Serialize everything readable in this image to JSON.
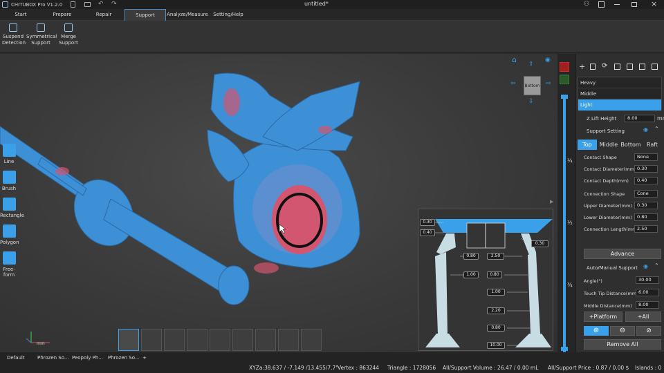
{
  "window": {
    "app_title": "CHITUBOX Pro V1.2.0",
    "doc_title": "untitled*"
  },
  "menu": [
    "Start",
    "Prepare",
    "Repair",
    "Support",
    "Analyze/Measure",
    "Setting/Help"
  ],
  "toolbar": [
    {
      "label1": "Suspend",
      "label2": "Detection",
      "icon": "suspend-detection-icon"
    },
    {
      "label1": "Symmetrical",
      "label2": "Support",
      "icon": "symmetrical-support-icon"
    },
    {
      "label1": "Merge",
      "label2": "Support",
      "icon": "merge-support-icon"
    }
  ],
  "left_tools": [
    "Line",
    "Brush",
    "Rectangle",
    "Polygon",
    "Free-form"
  ],
  "view_cube": {
    "label": "Bottom"
  },
  "slider_marks": [
    "¼",
    "½",
    "¾"
  ],
  "presets": [
    "Heavy",
    "Middle",
    "Light"
  ],
  "z_lift": {
    "label": "Z Lift Height",
    "value": "8.00",
    "unit": "mm"
  },
  "support_setting": {
    "title": "Support Setting",
    "tabs": [
      "Top",
      "Middle",
      "Bottom",
      "Raft"
    ],
    "rows": [
      {
        "label": "Contact Shape",
        "value": "None"
      },
      {
        "label": "Contact Diameter(mm)",
        "value": "0.30"
      },
      {
        "label": "Contact Depth(mm)",
        "value": "0.40"
      },
      {
        "label": "Connection Shape",
        "value": "Cone"
      },
      {
        "label": "Upper Diameter(mm)",
        "value": "0.30"
      },
      {
        "label": "Lower Diameter(mm)",
        "value": "0.80"
      },
      {
        "label": "Connection Length(mm)",
        "value": "2.50"
      }
    ],
    "advance": "Advance"
  },
  "auto_support": {
    "title": "Auto/Manual Support",
    "rows": [
      {
        "label": "Angle(°)",
        "value": "30.00"
      },
      {
        "label": "Touch Tip Distance(mm)",
        "value": "6.00"
      },
      {
        "label": "Middle Distance(mm)",
        "value": "8.00"
      }
    ],
    "platform": "+Platform",
    "all": "+All",
    "remove_all": "Remove All"
  },
  "diagram_labels": [
    "0.30",
    "0.40",
    "0.30",
    "0.80",
    "2.50",
    "1.00",
    "0.80",
    "1.00",
    "2.20",
    "0.80",
    "10.00"
  ],
  "axis_unit": "mm",
  "bottom_tabs": [
    "Default",
    "Phrozen So...",
    "Peopoly Ph...",
    "Phrozen So...",
    "+"
  ],
  "status": {
    "xyz": "XYZa:38.637 / -7.149 /13.455/7.7°",
    "vertex": "Vertex : 863244",
    "triangle": "Triangle : 1728056",
    "volume": "All/Support Volume : 26.47 / 0.00 mL",
    "price": "All/Support Price : 0.87 / 0.00 $",
    "islands": "Islands : 0"
  },
  "colors": {
    "accent": "#3aa0ea",
    "model": "#3d8fd6",
    "stress": "#d2566f"
  }
}
